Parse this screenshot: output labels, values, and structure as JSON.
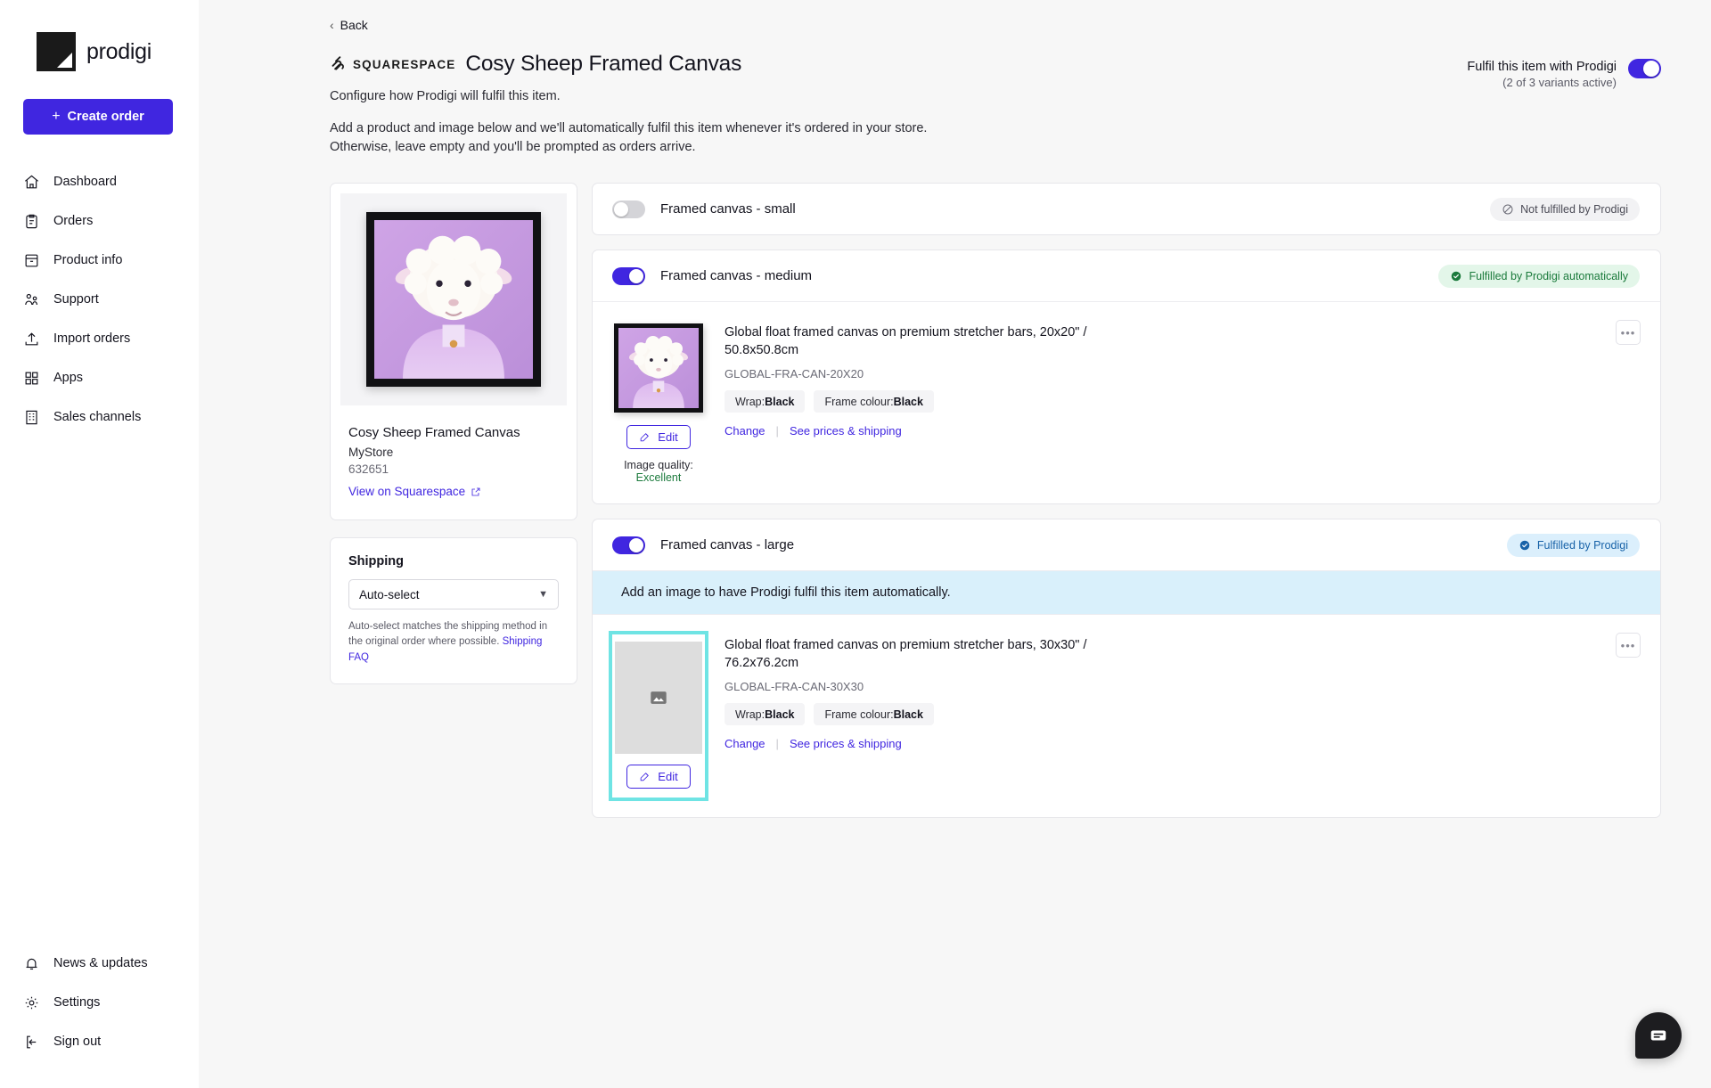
{
  "brand": {
    "name": "prodigi",
    "accent": "#4026e0"
  },
  "sidebar": {
    "create_order_label": "Create order",
    "items": [
      {
        "label": "Dashboard",
        "icon": "home-icon"
      },
      {
        "label": "Orders",
        "icon": "clipboard-icon"
      },
      {
        "label": "Product info",
        "icon": "archive-icon"
      },
      {
        "label": "Support",
        "icon": "people-icon"
      },
      {
        "label": "Import orders",
        "icon": "upload-icon"
      },
      {
        "label": "Apps",
        "icon": "grid-icon"
      },
      {
        "label": "Sales channels",
        "icon": "building-icon"
      }
    ],
    "bottom_items": [
      {
        "label": "News & updates",
        "icon": "bell-icon"
      },
      {
        "label": "Settings",
        "icon": "gear-icon"
      },
      {
        "label": "Sign out",
        "icon": "sign-out-icon"
      }
    ]
  },
  "header": {
    "back_label": "Back",
    "channel": "SQUARESPACE",
    "title": "Cosy Sheep Framed Canvas",
    "subtitle": "Configure how Prodigi will fulfil this item.",
    "intro_line1": "Add a product and image below and we'll automatically fulfil this item whenever it's ordered in your store.",
    "intro_line2": "Otherwise, leave empty and you'll be prompted as orders arrive.",
    "fulfil_toggle_label": "Fulfil this item with Prodigi",
    "fulfil_toggle_sub": "(2 of 3 variants active)",
    "fulfil_toggle_on": true
  },
  "product_card": {
    "name": "Cosy Sheep Framed Canvas",
    "store": "MyStore",
    "id": "632651",
    "link_label": "View on Squarespace"
  },
  "shipping_card": {
    "title": "Shipping",
    "selected": "Auto-select",
    "note_text": "Auto-select matches the shipping method in the original order where possible. ",
    "note_link": "Shipping FAQ"
  },
  "variants": [
    {
      "label": "Framed canvas - small",
      "toggle_on": false,
      "badge": {
        "text": "Not fulfilled by Prodigi",
        "style": "grey",
        "icon": "no-entry-icon"
      },
      "has_body": false
    },
    {
      "label": "Framed canvas - medium",
      "toggle_on": true,
      "badge": {
        "text": "Fulfilled by Prodigi automatically",
        "style": "green",
        "icon": "check-circle-icon"
      },
      "has_body": true,
      "notice": null,
      "thumb_type": "image",
      "highlighted": false,
      "edit_label": "Edit",
      "image_quality_label": "Image quality: ",
      "image_quality_value": "Excellent",
      "description": "Global float framed canvas on premium stretcher bars, 20x20\" / 50.8x50.8cm",
      "code": "GLOBAL-FRA-CAN-20X20",
      "attributes": [
        {
          "key": "Wrap: ",
          "value": "Black"
        },
        {
          "key": "Frame colour: ",
          "value": "Black"
        }
      ],
      "change_label": "Change",
      "prices_label": "See prices & shipping",
      "kebab_label": "•••"
    },
    {
      "label": "Framed canvas - large",
      "toggle_on": true,
      "badge": {
        "text": "Fulfilled by Prodigi",
        "style": "blue",
        "icon": "check-circle-icon"
      },
      "has_body": true,
      "notice": "Add an image to have Prodigi fulfil this item automatically.",
      "thumb_type": "placeholder",
      "highlighted": true,
      "edit_label": "Edit",
      "image_quality_label": null,
      "image_quality_value": null,
      "description": "Global float framed canvas on premium stretcher bars, 30x30\" / 76.2x76.2cm",
      "code": "GLOBAL-FRA-CAN-30X30",
      "attributes": [
        {
          "key": "Wrap: ",
          "value": "Black"
        },
        {
          "key": "Frame colour: ",
          "value": "Black"
        }
      ],
      "change_label": "Change",
      "prices_label": "See prices & shipping",
      "kebab_label": "•••"
    }
  ],
  "chat": {
    "icon": "chat-bubble-icon"
  }
}
